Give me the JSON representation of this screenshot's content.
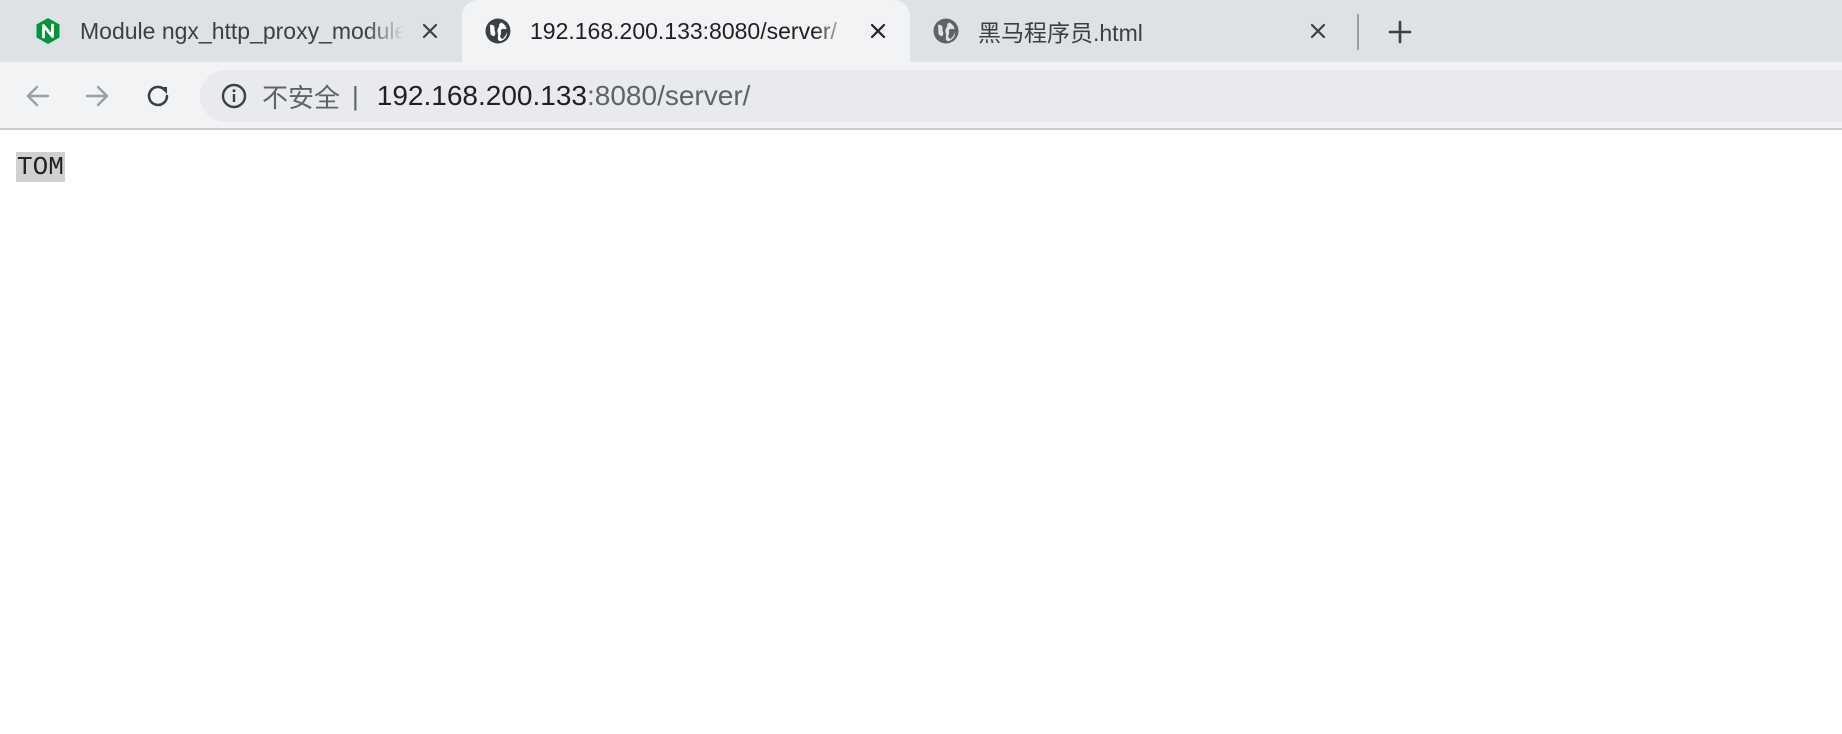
{
  "tabs": [
    {
      "title": "Module ngx_http_proxy_module",
      "favicon": "nginx-n-icon",
      "active": false
    },
    {
      "title": "192.168.200.133:8080/server/",
      "favicon": "globe-icon",
      "active": true
    },
    {
      "title": "黑马程序员.html",
      "favicon": "globe-icon",
      "active": false
    }
  ],
  "omnibox": {
    "security_label": "不安全",
    "separator": "|",
    "url_host": "192.168.200.133",
    "url_rest": ":8080/server/"
  },
  "page": {
    "body_text": "TOM"
  },
  "colors": {
    "tabstrip": "#dee1e6",
    "toolbar": "#f1f3f4",
    "omnibox": "#e8eaed",
    "nginx_green": "#009639"
  }
}
